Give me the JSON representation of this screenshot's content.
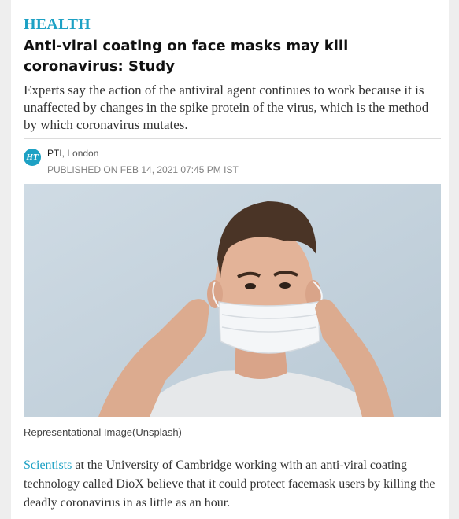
{
  "article": {
    "section": "HEALTH",
    "headline": "Anti-viral coating on face masks may kill coronavirus: Study",
    "summary": "Experts say the action of the antiviral agent continues to work because it is unaffected by changes in the spike protein of the virus, which is the method by which coronavirus mutates.",
    "byline": {
      "logo_text": "HT",
      "agency": "PTI",
      "location": ", London",
      "published": "PUBLISHED ON FEB 14, 2021 07:45 PM IST"
    },
    "image": {
      "caption": "Representational Image(Unsplash)"
    },
    "body": {
      "link_text": "Scientists",
      "text": " at the University of Cambridge working with an anti-viral coating technology called DioX believe that it could protect facemask users by killing the deadly coronavirus in as little as an hour."
    }
  },
  "colors": {
    "accent": "#1da1c4",
    "headline": "#111111",
    "text": "#333333"
  }
}
